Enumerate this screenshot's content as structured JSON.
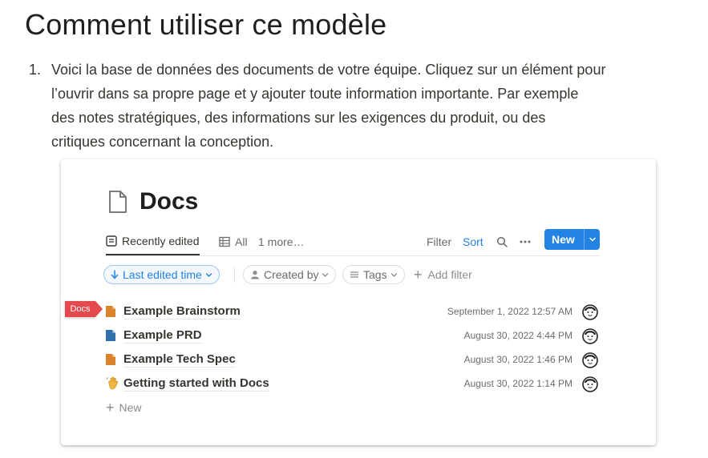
{
  "heading": "Comment utiliser ce modèle",
  "steps": [
    {
      "number": "1.",
      "lines": [
        "Voici la base de données des documents de votre équipe. Cliquez sur un élément pour",
        "l’ouvrir dans sa propre page et y ajouter toute information importante. Par exemple",
        "des notes stratégiques, des informations sur les exigences du produit, ou des",
        "critiques concernant la conception."
      ]
    }
  ],
  "screenshot": {
    "title": "Docs",
    "views": [
      {
        "label": "Recently edited",
        "active": true,
        "icon": "list-icon"
      },
      {
        "label": "All",
        "active": false,
        "icon": "table-icon"
      },
      {
        "label": "1 more…",
        "active": false
      }
    ],
    "toolbar": {
      "filter": "Filter",
      "sort": "Sort",
      "new": "New",
      "search_icon": "search-icon",
      "more_icon": "more-icon"
    },
    "filters": {
      "sort_chip": "Last edited time",
      "created_by": "Created by",
      "tags": "Tags",
      "add_filter": "Add filter"
    },
    "rows": [
      {
        "name": "Example Brainstorm",
        "date": "September 1, 2022 12:57 AM",
        "icon": "orange-doc-icon"
      },
      {
        "name": "Example PRD",
        "date": "August 30, 2022 4:44 PM",
        "icon": "blue-doc-icon"
      },
      {
        "name": "Example Tech Spec",
        "date": "August 30, 2022 1:46 PM",
        "icon": "orange-doc-icon"
      },
      {
        "name": "Getting started with Docs",
        "date": "August 30, 2022 1:14 PM",
        "icon": "waving-hand-icon"
      }
    ],
    "new_row": "New",
    "callout": "Docs"
  },
  "colors": {
    "accent": "#2383e2",
    "callout": "#e5484d",
    "orange_doc": "#d9822b",
    "blue_doc": "#2f6fab"
  }
}
